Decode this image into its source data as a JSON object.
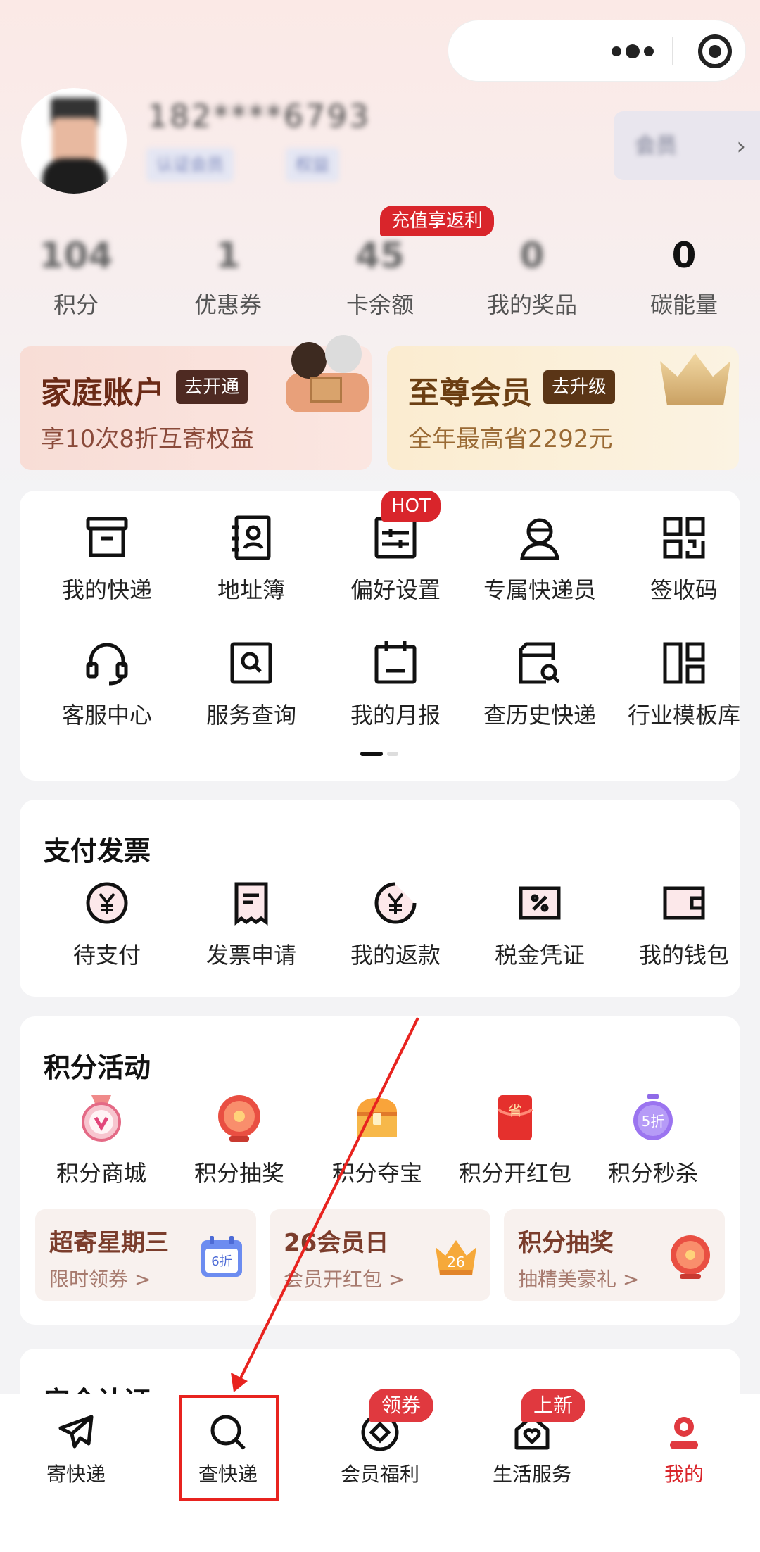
{
  "user": {
    "name": "182****6793",
    "tags": [
      "认证会员",
      "权益"
    ],
    "member_level": "会员"
  },
  "stats": [
    {
      "value": "104",
      "label": "积分"
    },
    {
      "value": "1",
      "label": "优惠券"
    },
    {
      "value": "45",
      "label": "卡余额"
    },
    {
      "value": "0",
      "label": "我的奖品"
    },
    {
      "value": "0",
      "label": "碳能量"
    }
  ],
  "recharge_badge": "充值享返利",
  "promos": {
    "family": {
      "title": "家庭账户",
      "button": "去开通",
      "subtitle": "享10次8折互寄权益"
    },
    "vip": {
      "title": "至尊会员",
      "button": "去升级",
      "subtitle": "全年最高省2292元"
    }
  },
  "grid": {
    "hot_badge": "HOT",
    "items": [
      {
        "label": "我的快递",
        "icon": "box-icon"
      },
      {
        "label": "地址簿",
        "icon": "address-book-icon"
      },
      {
        "label": "偏好设置",
        "icon": "sliders-icon"
      },
      {
        "label": "专属快递员",
        "icon": "courier-icon"
      },
      {
        "label": "签收码",
        "icon": "qr-code-icon"
      },
      {
        "label": "客服中心",
        "icon": "headset-icon"
      },
      {
        "label": "服务查询",
        "icon": "search-square-icon"
      },
      {
        "label": "我的月报",
        "icon": "calendar-icon"
      },
      {
        "label": "查历史快递",
        "icon": "history-search-icon"
      },
      {
        "label": "行业模板库",
        "icon": "template-icon"
      }
    ]
  },
  "payment": {
    "title": "支付发票",
    "items": [
      {
        "label": "待支付",
        "icon": "yen-circle-icon"
      },
      {
        "label": "发票申请",
        "icon": "invoice-icon"
      },
      {
        "label": "我的返款",
        "icon": "refund-icon"
      },
      {
        "label": "税金凭证",
        "icon": "tax-icon"
      },
      {
        "label": "我的钱包",
        "icon": "wallet-icon"
      }
    ]
  },
  "points": {
    "title": "积分活动",
    "items": [
      {
        "label": "积分商城",
        "icon": "medal-icon"
      },
      {
        "label": "积分抽奖",
        "icon": "wheel-icon"
      },
      {
        "label": "积分夺宝",
        "icon": "treasure-chest-icon"
      },
      {
        "label": "积分开红包",
        "icon": "red-envelope-icon"
      },
      {
        "label": "积分秒杀",
        "icon": "stopwatch-icon"
      }
    ],
    "envelope_char": "省",
    "stopwatch_text": "5折",
    "cards": [
      {
        "title": "超寄星期三",
        "subtitle": "限时领券 >",
        "icon_text": "6折"
      },
      {
        "title": "26会员日",
        "subtitle": "会员开红包 >",
        "icon_text": "26"
      },
      {
        "title": "积分抽奖",
        "subtitle": "抽精美豪礼 >",
        "icon_text": ""
      }
    ]
  },
  "security": {
    "title": "安全认证"
  },
  "tabbar": {
    "items": [
      {
        "label": "寄快递",
        "icon": "send-icon",
        "badge": ""
      },
      {
        "label": "查快递",
        "icon": "search-icon",
        "badge": ""
      },
      {
        "label": "会员福利",
        "icon": "gift-icon",
        "badge": "领券"
      },
      {
        "label": "生活服务",
        "icon": "home-heart-icon",
        "badge": "上新"
      },
      {
        "label": "我的",
        "icon": "user-icon",
        "badge": ""
      }
    ],
    "active_color": "#d9252b"
  },
  "colors": {
    "accent_red": "#d9252b",
    "annotation_red": "#e8231f"
  }
}
